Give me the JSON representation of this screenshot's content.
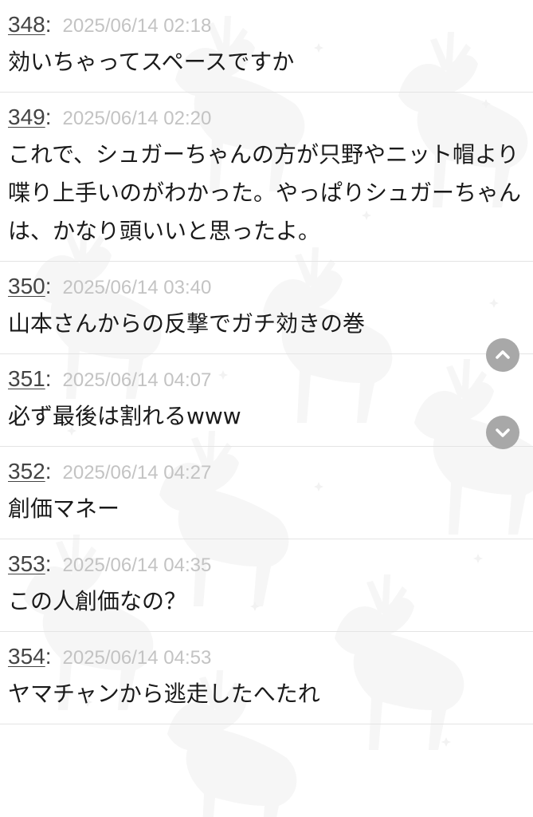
{
  "posts": [
    {
      "number": "348",
      "date": "2025/06/14 02:18",
      "body": "効いちゃってスペースですか"
    },
    {
      "number": "349",
      "date": "2025/06/14 02:20",
      "body": "これで、シュガーちゃんの方が只野やニット帽より喋り上手いのがわかった。やっぱりシュガーちゃんは、かなり頭いいと思ったよ。"
    },
    {
      "number": "350",
      "date": "2025/06/14 03:40",
      "body": "山本さんからの反撃でガチ効きの巻"
    },
    {
      "number": "351",
      "date": "2025/06/14 04:07",
      "body": "必ず最後は割れるwww"
    },
    {
      "number": "352",
      "date": "2025/06/14 04:27",
      "body": "創価マネー"
    },
    {
      "number": "353",
      "date": "2025/06/14 04:35",
      "body": "この人創価なの？"
    },
    {
      "number": "354",
      "date": "2025/06/14 04:53",
      "body": "ヤマチャンから逃走したへたれ"
    }
  ],
  "controls": {
    "scroll_up_icon": "chevron-up-icon",
    "scroll_down_icon": "chevron-down-icon"
  },
  "colors": {
    "number": "#444444",
    "date": "#c3c3c3",
    "body": "#1a1a1a",
    "divider": "#e4e4e4",
    "scroll_button": "#a8a8a8"
  }
}
